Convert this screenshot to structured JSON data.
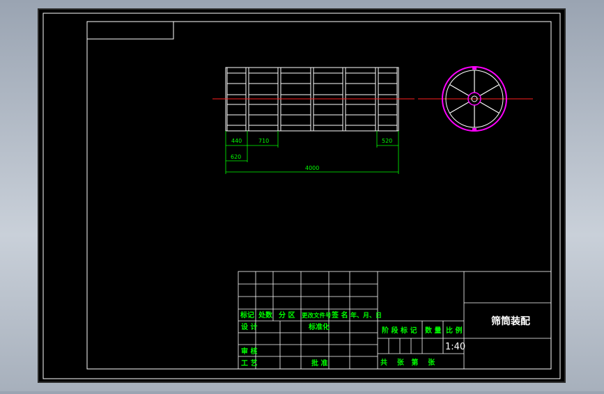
{
  "drawing": {
    "title": "筛筒装配",
    "scale": "1:40"
  },
  "dimensions": {
    "d440": "440",
    "d710": "710",
    "d520": "520",
    "d620": "620",
    "d4000": "4000"
  },
  "title_block": {
    "row_labels": [
      "标记",
      "处数",
      "分 区",
      "更改文件号",
      "签 名",
      "年、月、日"
    ],
    "design": "设 计",
    "standardize": "标准化",
    "review": "审 核",
    "process": "工 艺",
    "approve": "批 准",
    "stage_mark": "阶 段 标 记",
    "weight": "数 量",
    "ratio": "比 例",
    "sheets": "共    张   第    张"
  },
  "colors": {
    "background": "#000000",
    "frame": "#ffffff",
    "dimension": "#00ff00",
    "centerline": "#ff0000",
    "wheel": "#ff00ff"
  }
}
